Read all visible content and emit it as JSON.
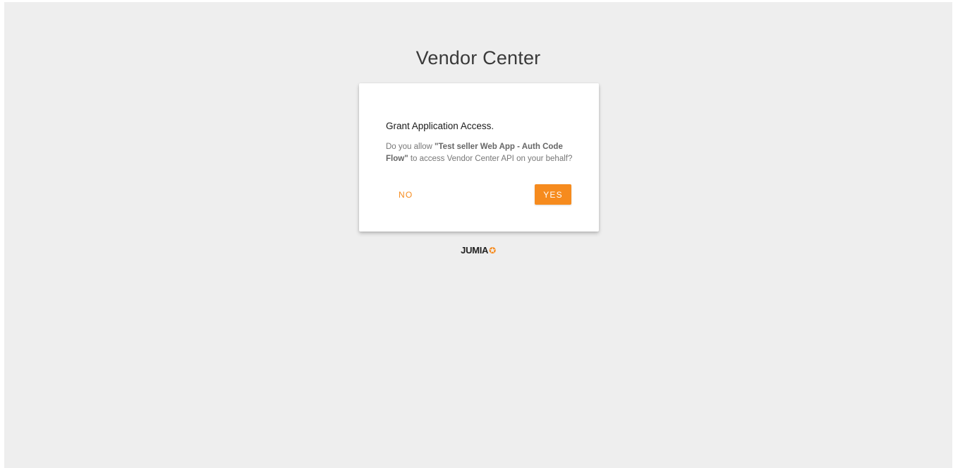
{
  "header": {
    "title": "Vendor Center"
  },
  "dialog": {
    "title": "Grant Application Access.",
    "message_prefix": "Do you allow ",
    "app_name": "\"Test seller Web App - Auth Code Flow\"",
    "message_suffix": " to access Vendor Center API on your behalf?",
    "no_label": "NO",
    "yes_label": "YES"
  },
  "footer": {
    "logo_text": "JUMIA",
    "logo_icon": "star-icon"
  },
  "colors": {
    "accent": "#f68b1e",
    "background": "#eeeeee",
    "card": "#ffffff"
  }
}
